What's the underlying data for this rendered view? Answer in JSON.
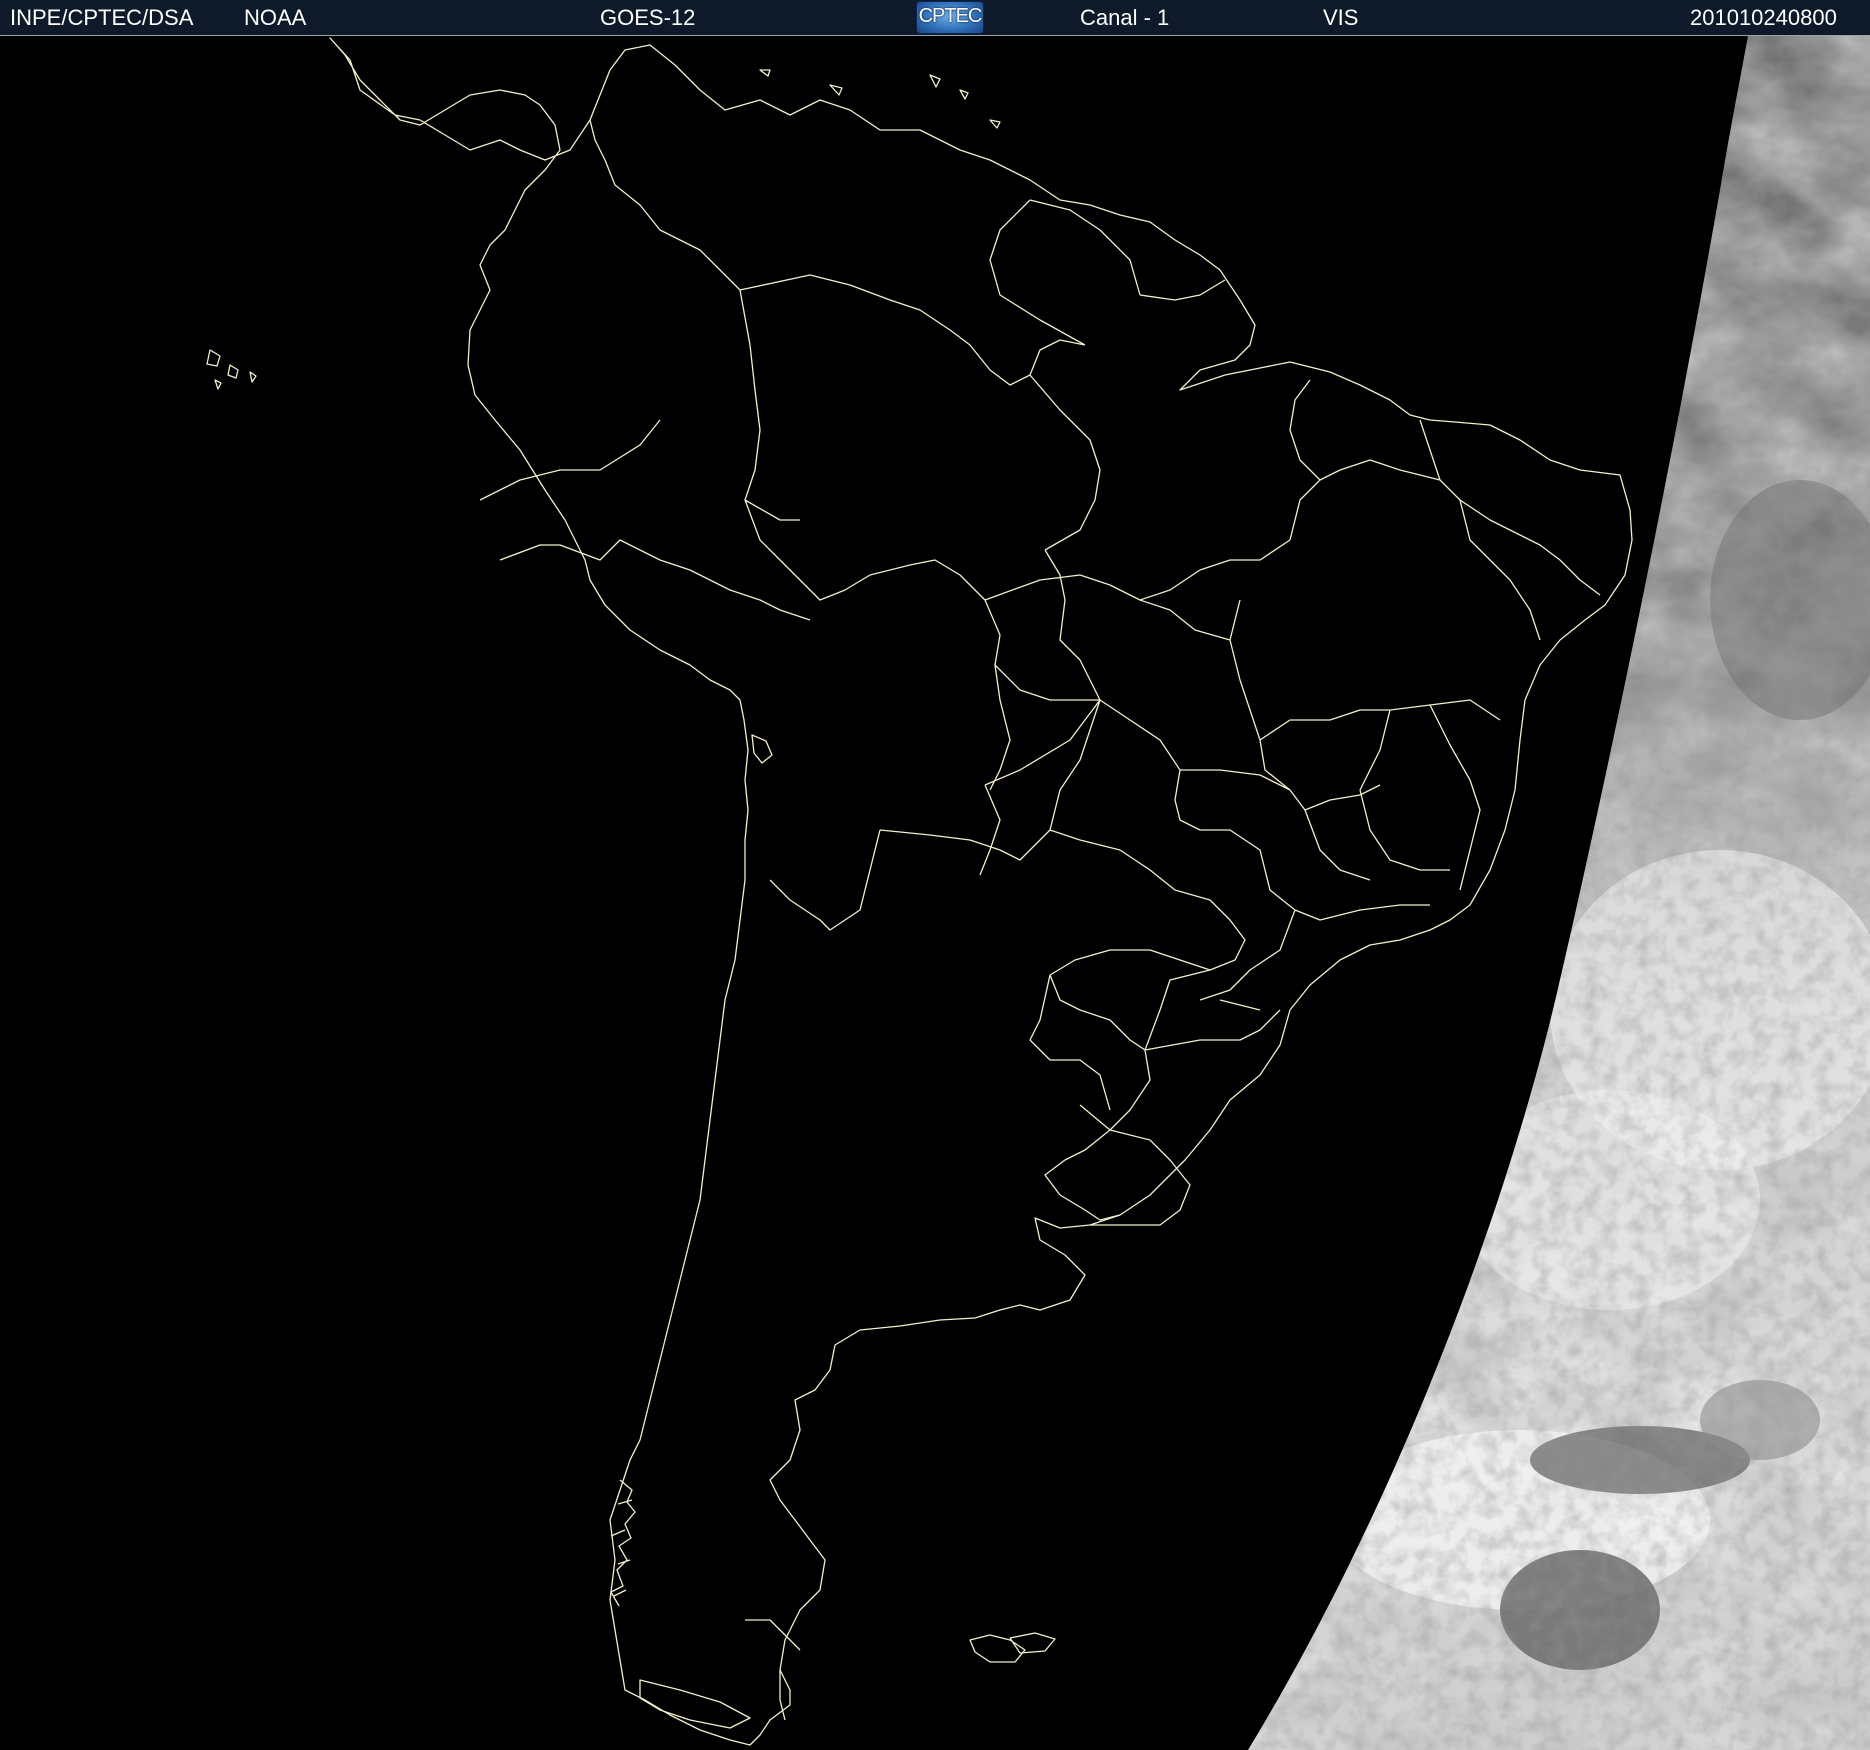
{
  "header": {
    "agency": "INPE/CPTEC/DSA",
    "source": "NOAA",
    "satellite": "GOES-12",
    "logo_text": "CPTEC",
    "channel": "Canal - 1",
    "band": "VIS",
    "timestamp": "201010240800"
  },
  "colors": {
    "header_background": "#0e1a2a",
    "header_text": "#ffffff",
    "map_outline": "#f2f0c8",
    "night_side": "#000000",
    "cloud_bright": "#f4f4f4",
    "cloud_grey": "#8a8a8a"
  },
  "icons": {
    "logo": "cptec-logo-icon"
  }
}
